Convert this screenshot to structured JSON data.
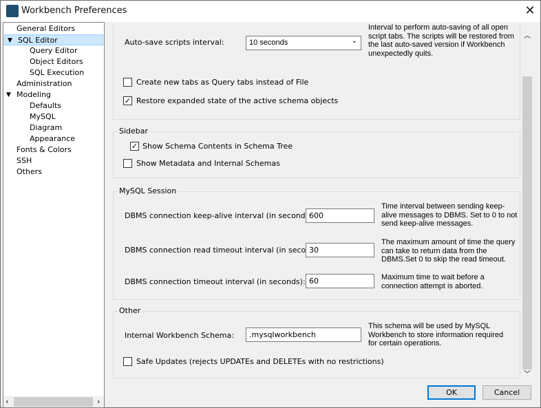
{
  "window": {
    "title": "Workbench Preferences",
    "close": "✕"
  },
  "tree": {
    "items": [
      {
        "label": "General Editors",
        "level": 0
      },
      {
        "label": "SQL Editor",
        "level": 0,
        "expanded": true,
        "selected": true
      },
      {
        "label": "Query Editor",
        "level": 1
      },
      {
        "label": "Object Editors",
        "level": 1
      },
      {
        "label": "SQL Execution",
        "level": 1
      },
      {
        "label": "Administration",
        "level": 0
      },
      {
        "label": "Modeling",
        "level": 0,
        "expanded": true
      },
      {
        "label": "Defaults",
        "level": 1
      },
      {
        "label": "MySQL",
        "level": 1
      },
      {
        "label": "Diagram",
        "level": 1
      },
      {
        "label": "Appearance",
        "level": 1
      },
      {
        "label": "Fonts & Colors",
        "level": 0
      },
      {
        "label": "SSH",
        "level": 0
      },
      {
        "label": "Others",
        "level": 0
      }
    ]
  },
  "editor": {
    "autosave_label": "Auto-save scripts interval:",
    "autosave_value": "10 seconds",
    "autosave_desc": "Interval to perform auto-saving of all open script tabs. The scripts will be restored from the last auto-saved version if Workbench unexpectedly quits.",
    "query_tabs_label": "Create new tabs as Query tabs instead of File",
    "query_tabs_checked": false,
    "restore_label": "Restore expanded state of the active schema objects",
    "restore_checked": true
  },
  "sidebar": {
    "title": "Sidebar",
    "schema_contents_label": "Show Schema Contents in Schema Tree",
    "schema_contents_checked": true,
    "metadata_label": "Show Metadata and Internal Schemas",
    "metadata_checked": false
  },
  "session": {
    "title": "MySQL Session",
    "keepalive_label": "DBMS connection keep-alive interval (in seconds):",
    "keepalive_value": "600",
    "keepalive_desc": "Time interval between sending keep-alive messages to DBMS. Set to 0 to not send keep-alive messages.",
    "read_timeout_label": "DBMS connection read timeout interval (in seconds):",
    "read_timeout_value": "30",
    "read_timeout_desc": "The maximum amount of time the query can take to return data from the DBMS.Set 0 to skip the read timeout.",
    "timeout_label": "DBMS connection timeout interval (in seconds):",
    "timeout_value": "60",
    "timeout_desc": "Maximum time to wait before a connection attempt is aborted."
  },
  "other": {
    "title": "Other",
    "schema_label": "Internal Workbench Schema:",
    "schema_value": ".mysqlworkbench",
    "schema_desc": "This schema will be used by MySQL Workbench to store information required for certain operations.",
    "safe_updates_label": "Safe Updates (rejects UPDATEs and DELETEs with no restrictions)",
    "safe_updates_checked": false
  },
  "buttons": {
    "ok": "OK",
    "cancel": "Cancel"
  }
}
